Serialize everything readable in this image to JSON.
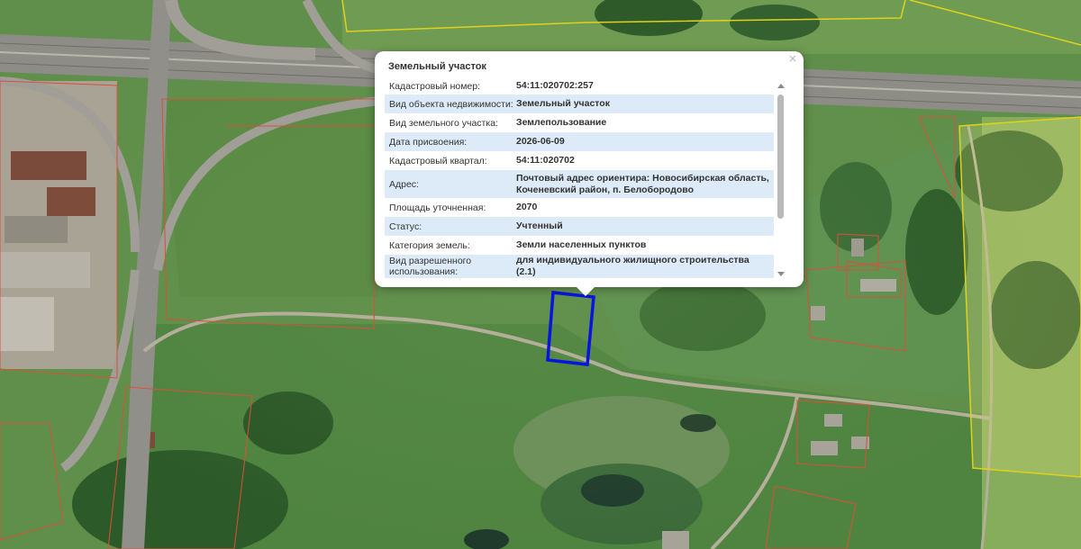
{
  "popup": {
    "title": "Земельный участок",
    "close_glyph": "×",
    "rows": [
      {
        "label": "Кадастровый номер:",
        "value": "54:11:020702:257"
      },
      {
        "label": "Вид объекта недвижимости:",
        "value": "Земельный участок"
      },
      {
        "label": "Вид земельного участка:",
        "value": "Землепользование"
      },
      {
        "label": "Дата присвоения:",
        "value": "2026-06-09"
      },
      {
        "label": "Кадастровый квартал:",
        "value": "54:11:020702"
      },
      {
        "label": "Адрес:",
        "value": "Почтовый адрес ориентира: Новосибирская область, Коченевский район, п. Белобородово"
      },
      {
        "label": "Площадь уточненная:",
        "value": "2070"
      },
      {
        "label": "Статус:",
        "value": "Учтенный"
      },
      {
        "label": "Категория земель:",
        "value": "Земли населенных пунктов"
      },
      {
        "label": "Вид разрешенного использования:",
        "value": "для индивидуального жилищного строительства (2.1)"
      }
    ]
  },
  "colors": {
    "selected_parcel": "#0a14e0",
    "parcel_boundary": "#d9503a",
    "zone_boundary": "#e0d21a",
    "row_highlight": "#dcebf7"
  }
}
